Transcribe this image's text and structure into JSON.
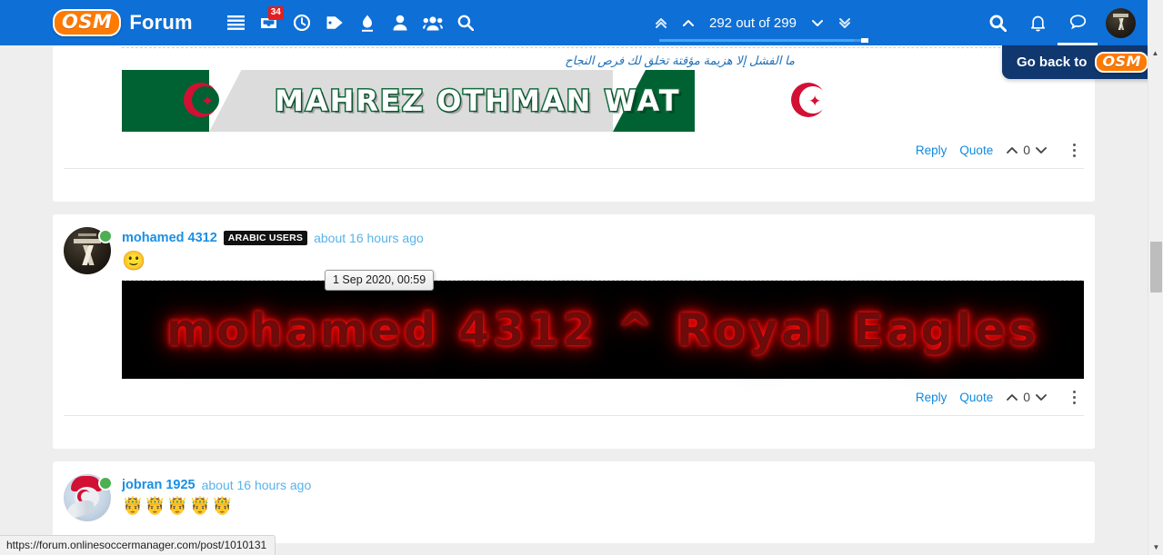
{
  "nav": {
    "logo_text": "OSM",
    "brand": "Forum",
    "icons": [
      {
        "name": "menu-icon",
        "label": "Menu"
      },
      {
        "name": "inbox-icon",
        "label": "Inbox",
        "badge": "34"
      },
      {
        "name": "clock-icon",
        "label": "Recent"
      },
      {
        "name": "tag-icon",
        "label": "Tags"
      },
      {
        "name": "flame-icon",
        "label": "Popular"
      },
      {
        "name": "user-icon",
        "label": "Users"
      },
      {
        "name": "group-icon",
        "label": "Groups"
      },
      {
        "name": "search-icon",
        "label": "Search"
      }
    ],
    "pager": {
      "first_label": "«",
      "prev_label": "∧",
      "position": "292 out of 299",
      "next_label": "∨",
      "last_label": "»",
      "progress_percent": 93
    },
    "right_icons": [
      {
        "name": "search-icon",
        "label": "Search"
      },
      {
        "name": "bell-icon",
        "label": "Notifications"
      },
      {
        "name": "chat-icon",
        "label": "Chats"
      }
    ],
    "avatar_name": "user-avatar"
  },
  "goback": {
    "label": "Go back to",
    "logo_text": "OSM"
  },
  "posts": [
    {
      "id": "post-1",
      "signature_text": "ما الفشل إلا هزيمة مؤقتة تخلق لك فرص النجاح",
      "banner_text": "MAHREZ OTHMAN WAT",
      "actions": {
        "reply": "Reply",
        "quote": "Quote",
        "votes": "0"
      }
    },
    {
      "id": "post-2",
      "username": "mohamed 4312",
      "badge": "ARABIC USERS",
      "timeago": "about 16 hours ago",
      "tooltip": "1 Sep 2020, 00:59",
      "emoji": "🙂",
      "signature_image_text": "mohamed 4312 ^ Royal Eagles",
      "actions": {
        "reply": "Reply",
        "quote": "Quote",
        "votes": "0"
      }
    },
    {
      "id": "post-3",
      "username": "jobran 1925",
      "timeago": "about 16 hours ago",
      "emoji": "🤴🤴🤴🤴🤴"
    }
  ],
  "statusbar": {
    "url": "https://forum.onlinesoccermanager.com/post/1010131"
  },
  "colors": {
    "nav_blue": "#0e6fd6",
    "link_blue": "#1a8fe3",
    "osm_orange": "#ff7a00",
    "goback_navy": "#10376e",
    "badge_red": "#e02020",
    "online_green": "#4caf50"
  }
}
